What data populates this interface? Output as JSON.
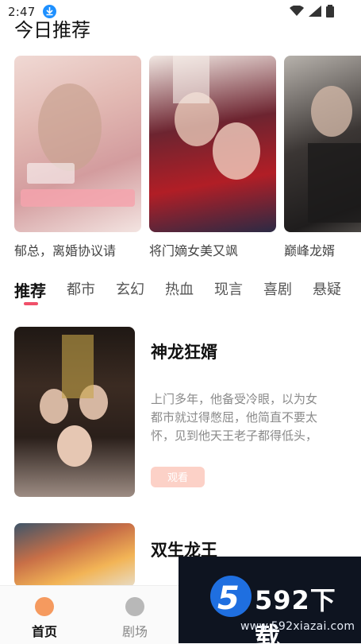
{
  "status_bar": {
    "time": "2:47"
  },
  "header": {
    "title": "今日推荐"
  },
  "recommended": [
    {
      "caption": "郁总，离婚协议请"
    },
    {
      "caption": "将门嫡女美又飒"
    },
    {
      "caption": "巅峰龙婿"
    }
  ],
  "tabs": [
    "推荐",
    "都市",
    "玄幻",
    "热血",
    "现言",
    "喜剧",
    "悬疑"
  ],
  "list": [
    {
      "name": "神龙狂婿",
      "description": [
        "上门多年，他备受冷眼，以为女",
        "都市就过得憋屈，他简直不要太",
        "怀，见到他天王老子都得低头，"
      ],
      "watch_label": "观看"
    },
    {
      "name": "双生龙王"
    }
  ],
  "bottom_nav": [
    {
      "label": "首页",
      "icon": "compass-icon"
    },
    {
      "label": "剧场",
      "icon": "clock-icon"
    }
  ],
  "watermark": {
    "logo_number": "5",
    "brand": "592下载",
    "url": "www.592xiazai.com"
  },
  "colors": {
    "accent": "#f0506a",
    "watch_button": "#fcd1c7",
    "home_icon": "#f59a5f"
  }
}
